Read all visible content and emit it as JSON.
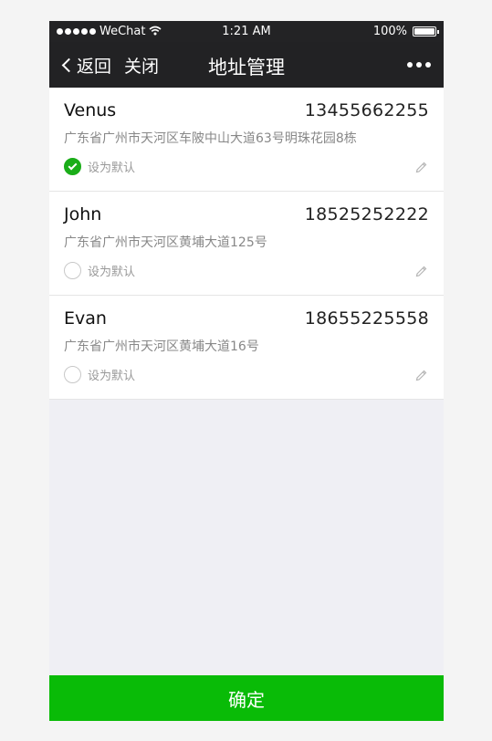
{
  "status_bar": {
    "carrier": "WeChat",
    "time": "1:21 AM",
    "battery": "100%",
    "battery_level": 1.0,
    "wifi_icon": "wifi-icon"
  },
  "nav": {
    "back_label": "返回",
    "close_label": "关闭",
    "title": "地址管理",
    "more_icon": "more-icon"
  },
  "addresses": [
    {
      "name": "Venus",
      "phone": "13455662255",
      "address": "广东省广州市天河区车陂中山大道63号明珠花园8栋",
      "default_label": "设为默认",
      "is_default": true
    },
    {
      "name": "John",
      "phone": "18525252222",
      "address": "广东省广州市天河区黄埔大道125号",
      "default_label": "设为默认",
      "is_default": false
    },
    {
      "name": "Evan",
      "phone": "18655225558",
      "address": "广东省广州市天河区黄埔大道16号",
      "default_label": "设为默认",
      "is_default": false
    }
  ],
  "confirm_label": "确定",
  "colors": {
    "accent": "#09bb07",
    "check": "#1aad19",
    "navbar": "#222224"
  }
}
